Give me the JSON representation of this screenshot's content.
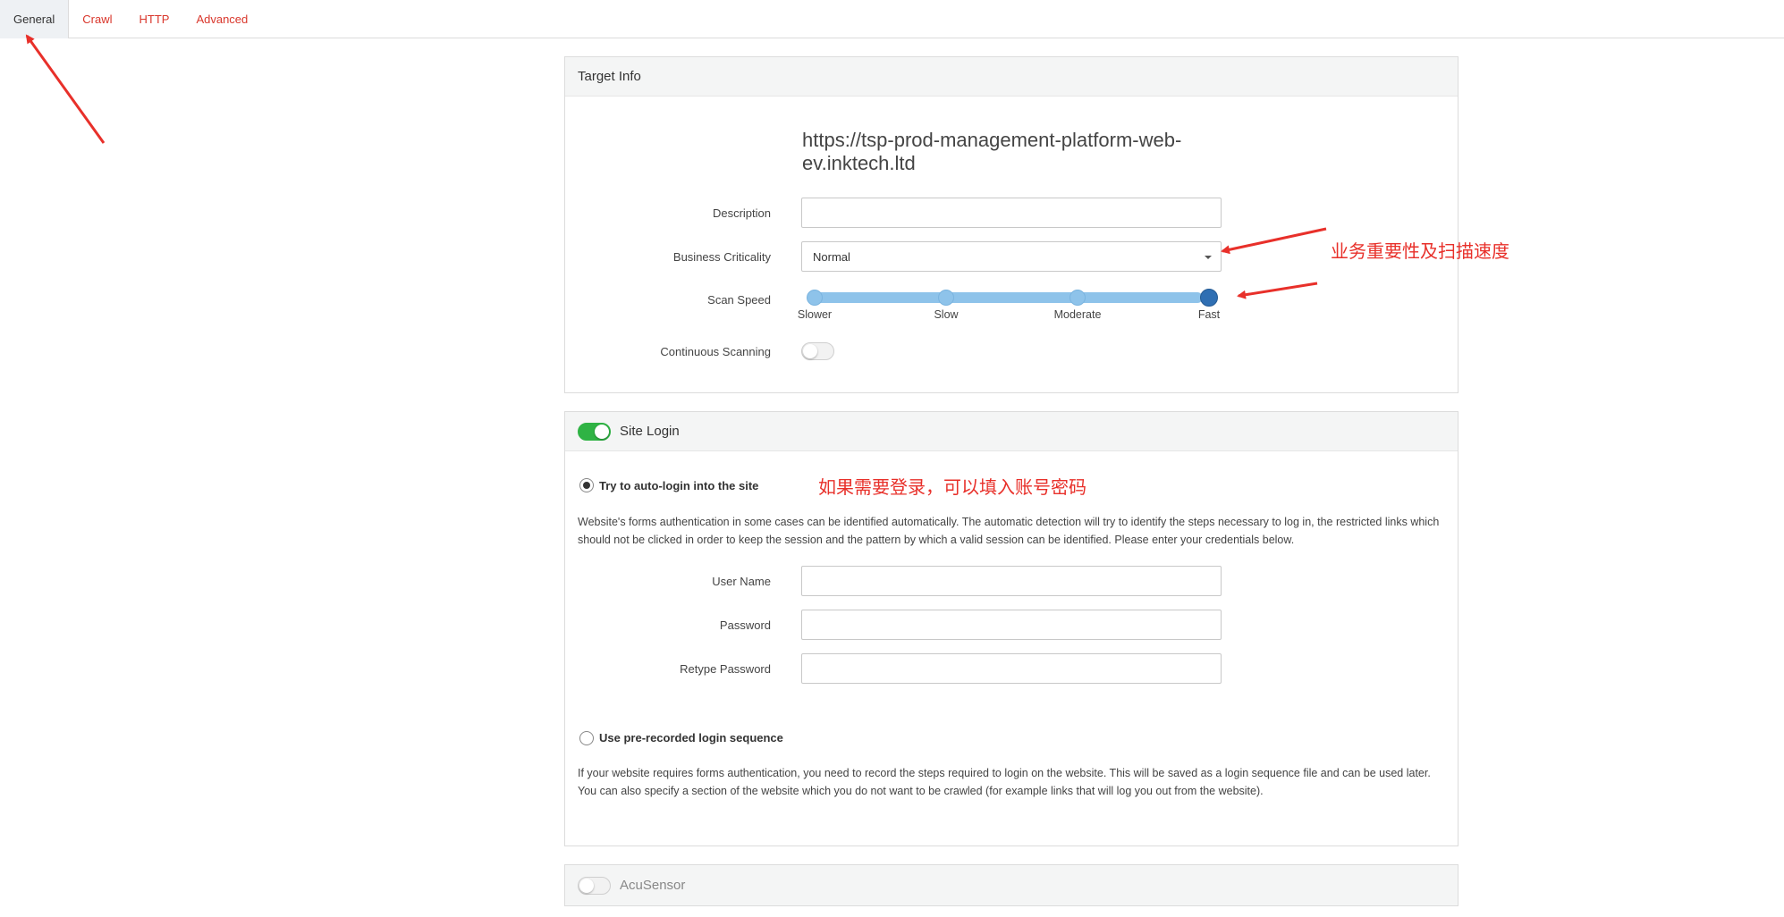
{
  "tabs": [
    {
      "label": "General",
      "active": true
    },
    {
      "label": "Crawl",
      "active": false
    },
    {
      "label": "HTTP",
      "active": false
    },
    {
      "label": "Advanced",
      "active": false
    }
  ],
  "target_info": {
    "title": "Target Info",
    "url": "https://tsp-prod-management-platform-web-ev.inktech.ltd",
    "description_label": "Description",
    "description_value": "",
    "criticality_label": "Business Criticality",
    "criticality_value": "Normal",
    "scan_speed_label": "Scan Speed",
    "scan_speed_options": [
      "Slower",
      "Slow",
      "Moderate",
      "Fast"
    ],
    "scan_speed_selected": "Fast",
    "continuous_label": "Continuous Scanning",
    "continuous_on": false
  },
  "site_login": {
    "title": "Site Login",
    "enabled": true,
    "auto_login_label": "Try to auto-login into the site",
    "auto_login_selected": true,
    "auto_login_desc": "Website's forms authentication in some cases can be identified automatically. The automatic detection will try to identify the steps necessary to log in, the restricted links which should not be clicked in order to keep the session and the pattern by which a valid session can be identified. Please enter your credentials below.",
    "username_label": "User Name",
    "password_label": "Password",
    "retype_label": "Retype Password",
    "prerecorded_label": "Use pre-recorded login sequence",
    "prerecorded_selected": false,
    "prerecorded_desc": "If your website requires forms authentication, you need to record the steps required to login on the website. This will be saved as a login sequence file and can be used later. You can also specify a section of the website which you do not want to be crawled (for example links that will log you out from the website)."
  },
  "acusensor": {
    "title": "AcuSensor",
    "enabled": false
  },
  "annotations": {
    "criticality_note": "业务重要性及扫描速度",
    "login_note": "如果需要登录，可以填入账号密码"
  },
  "colors": {
    "tab_link": "#d9362b",
    "annotation": "#e8302a",
    "toggle_on": "#2fb344",
    "slider": "#8ec3ea",
    "slider_selected": "#2f6fb3"
  }
}
